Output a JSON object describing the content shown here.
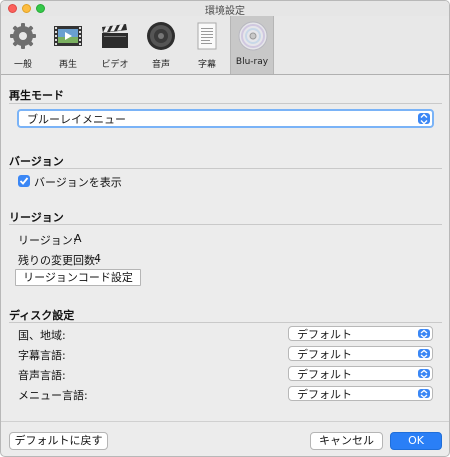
{
  "window": {
    "title": "環境設定"
  },
  "toolbar": {
    "items": [
      {
        "label": "一般",
        "icon": "gear-icon"
      },
      {
        "label": "再生",
        "icon": "film-play-icon"
      },
      {
        "label": "ビデオ",
        "icon": "clapperboard-icon"
      },
      {
        "label": "音声",
        "icon": "speaker-icon"
      },
      {
        "label": "字幕",
        "icon": "subtitle-document-icon"
      },
      {
        "label": "Blu-ray",
        "icon": "disc-icon",
        "selected": true
      }
    ]
  },
  "playback_mode": {
    "title": "再生モード",
    "value": "ブルーレイメニュー"
  },
  "version": {
    "title": "バージョン",
    "show_version_label": "バージョンを表示",
    "checked": true
  },
  "region": {
    "title": "リージョン",
    "region_label": "リージョン:",
    "region_value": "A",
    "remaining_label": "残りの変更回数:",
    "remaining_value": "4",
    "set_button": "リージョンコード設定"
  },
  "disc": {
    "title": "ディスク設定",
    "rows": [
      {
        "label": "国、地域:",
        "value": "デフォルト"
      },
      {
        "label": "字幕言語:",
        "value": "デフォルト"
      },
      {
        "label": "音声言語:",
        "value": "デフォルト"
      },
      {
        "label": "メニュー言語:",
        "value": "デフォルト"
      }
    ]
  },
  "footer": {
    "reset_button": "デフォルトに戻す",
    "cancel_button": "キャンセル",
    "ok_button": "OK"
  },
  "colors": {
    "accent": "#3b87f5",
    "primary_button": "#2a7ff6"
  }
}
